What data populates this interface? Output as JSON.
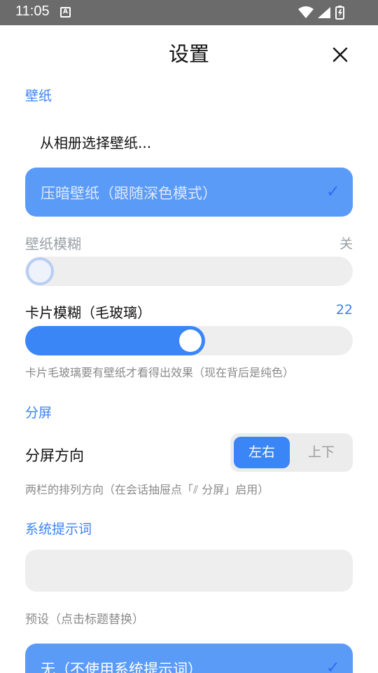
{
  "status_bar": {
    "time": "11:05",
    "notification_icon": "A"
  },
  "header": {
    "title": "设置",
    "close_icon": "close-icon"
  },
  "wallpaper": {
    "section_label": "壁纸",
    "choose_from_album": "从相册选择壁纸...",
    "dim_option": {
      "label": "压暗壁纸（跟随深色模式）",
      "selected": true,
      "check": "✓"
    },
    "blur": {
      "label": "壁纸模糊",
      "value": "关",
      "enabled": false,
      "level": 0
    },
    "card_blur": {
      "label": "卡片模糊（毛玻璃）",
      "value": "22",
      "level": 0.55
    },
    "card_blur_hint": "卡片毛玻璃要有壁纸才看得出效果（现在背后是纯色）"
  },
  "split": {
    "section_label": "分屏",
    "direction_label": "分屏方向",
    "options": [
      "左右",
      "上下"
    ],
    "selected": "左右",
    "hint": "两栏的排列方向（在会话抽屉点「⫽ 分屏」启用）"
  },
  "system_prompt": {
    "section_label": "系统提示词",
    "input_value": "",
    "presets_label": "预设（点击标题替换）",
    "preset_none": {
      "label": "无（不使用系统提示词）",
      "selected": true,
      "check": "✓"
    }
  },
  "colors": {
    "accent": "#3a86f7",
    "selected_pill": "#5b9bf8",
    "status_bar": "#6b6b6b"
  }
}
